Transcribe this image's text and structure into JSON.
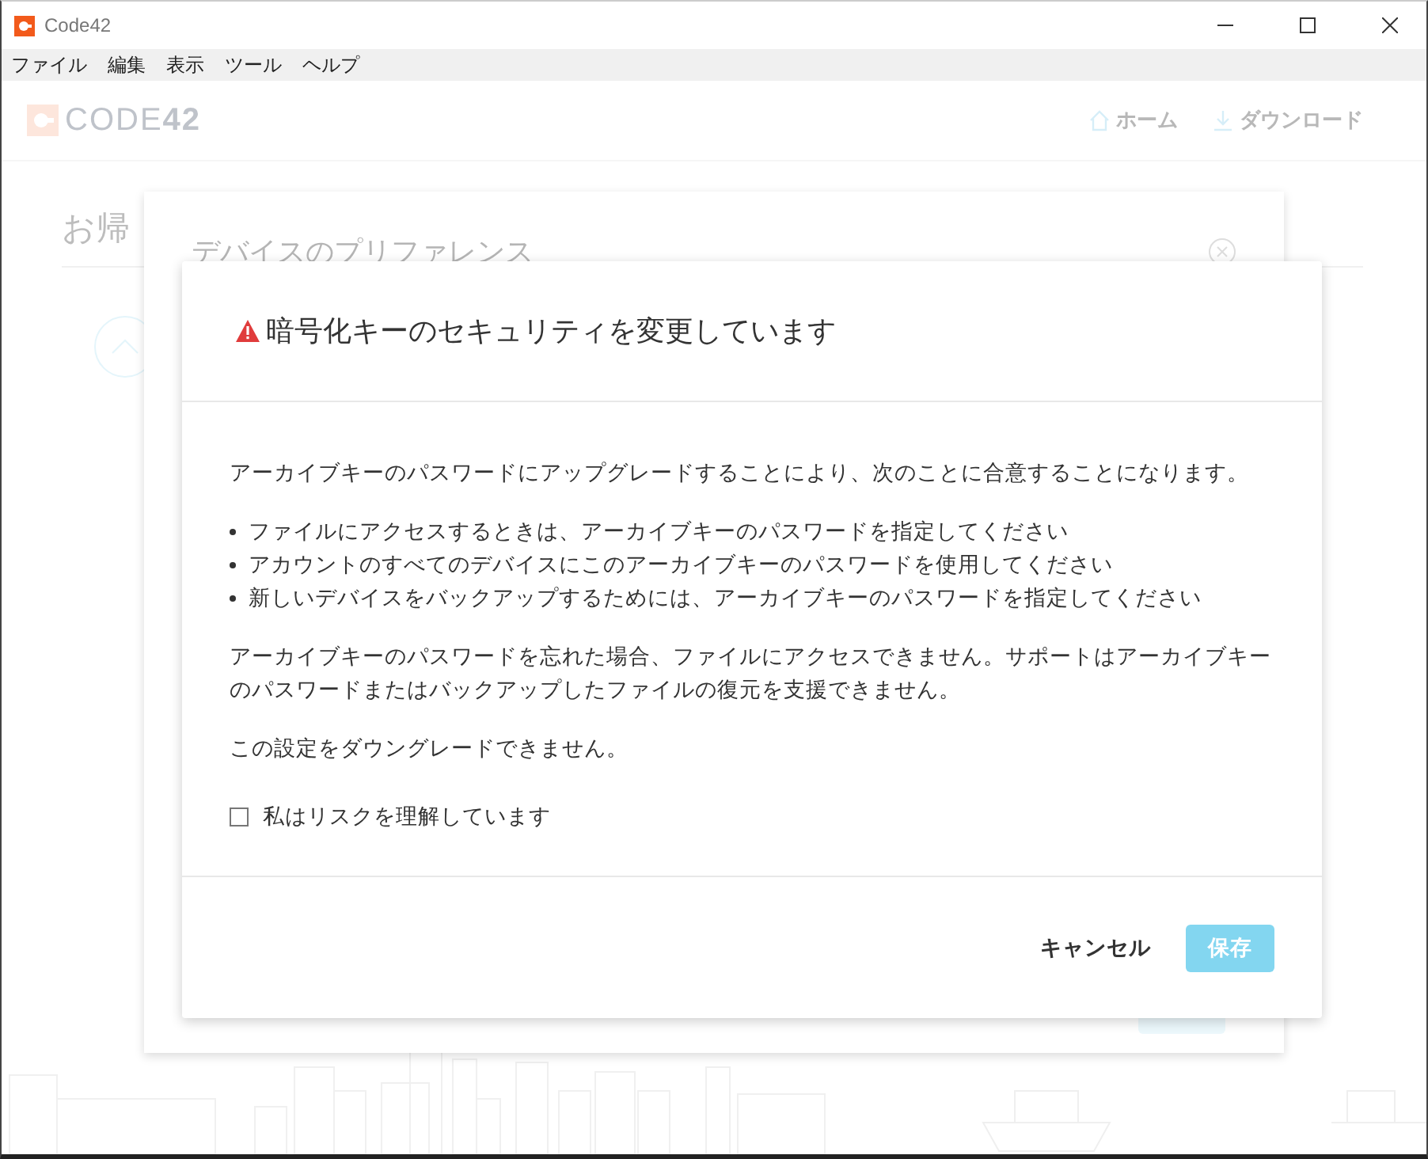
{
  "window": {
    "title": "Code42"
  },
  "menu": [
    "ファイル",
    "編集",
    "表示",
    "ツール",
    "ヘルプ"
  ],
  "app_header": {
    "logo": "CODE**42**",
    "nav": [
      {
        "label": "ホーム",
        "kind": "home"
      },
      {
        "label": "ダウンロード",
        "kind": "download"
      }
    ]
  },
  "background_page": {
    "heading": "お帰"
  },
  "back_dialog": {
    "title": "デバイスのプリファレンス"
  },
  "dialog": {
    "title": "暗号化キーのセキュリティを変更しています",
    "intro": "アーカイブキーのパスワードにアップグレードすることにより、次のことに合意することになります。",
    "bullets": [
      "ファイルにアクセスするときは、アーカイブキーのパスワードを指定してください",
      "アカウントのすべてのデバイスにこのアーカイブキーのパスワードを使用してください",
      "新しいデバイスをバックアップするためには、アーカイブキーのパスワードを指定してください"
    ],
    "paragraphs": [
      "アーカイブキーのパスワードを忘れた場合、ファイルにアクセスできません。サポートはアーカイブキーのパスワードまたはバックアップしたファイルの復元を支援できません。",
      "この設定をダウングレードできません。"
    ],
    "checkbox": {
      "label": "私はリスクを理解しています",
      "checked": false
    },
    "buttons": [
      {
        "label": "キャンセル",
        "kind": "text",
        "disabled": false
      },
      {
        "label": "保存",
        "kind": "primary",
        "disabled": true
      }
    ]
  }
}
